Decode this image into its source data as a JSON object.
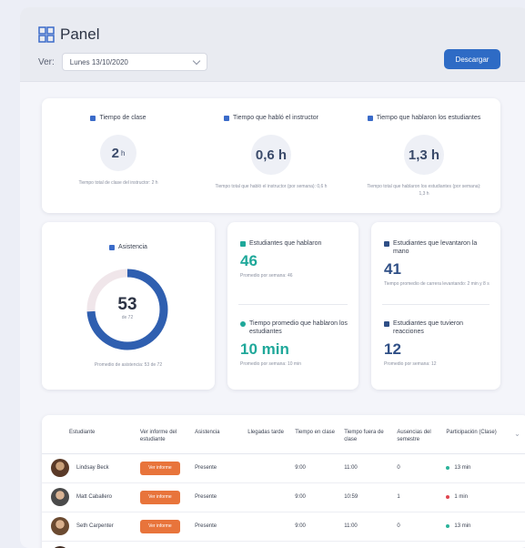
{
  "header": {
    "title": "Panel",
    "view_label": "Ver:",
    "date_value": "Lunes 13/10/2020",
    "download_label": "Descargar"
  },
  "stats": [
    {
      "label": "Tiempo de clase",
      "value": "2",
      "unit": "h",
      "note": "Tiempo total de clase del instructor: 2 h"
    },
    {
      "label": "Tiempo que habló el instructor",
      "value": "0,6 h",
      "unit": "",
      "note": "Tiempo total que habló el instructor (por semana): 0,6 h"
    },
    {
      "label": "Tiempo que hablaron los estudiantes",
      "value": "1,3 h",
      "unit": "",
      "note": "Tiempo total que hablaron los estudiantes (por semana): 1,3 h"
    }
  ],
  "attendance": {
    "label": "Asistencia",
    "value": "53",
    "sub": "de 72",
    "note": "Promedio de asistencia: 53 de 72",
    "fraction": 0.74
  },
  "metrics": {
    "students_talked": {
      "label": "Estudiantes que hablaron",
      "value": "46",
      "note": "Promedio por semana: 46"
    },
    "avg_talk_time": {
      "label": "Tiempo promedio que hablaron los estudiantes",
      "value": "10 min",
      "note": "Promedio por semana: 10 min"
    },
    "raised_hand": {
      "label": "Estudiantes que levantaron la mano",
      "value": "41",
      "note": "Tiempo promedio de carrera levantando: 2 min y 8 s"
    },
    "reactions": {
      "label": "Estudiantes que tuvieron reacciones",
      "value": "12",
      "note": "Promedio por semana: 12"
    }
  },
  "table": {
    "columns": [
      "Estudiante",
      "Ver informe del estudiante",
      "Asistencia",
      "Llegadas tarde",
      "Tiempo en clase",
      "Tiempo fuera de clase",
      "Ausencias del semestre",
      "Participación (Clase)"
    ],
    "rows": [
      {
        "name": "Lindsay Beck",
        "report": "Ver informe",
        "attendance": "Presente",
        "late": "",
        "in_class": "9:00",
        "out_class": "11:00",
        "absences": "0",
        "participation": "13 min",
        "part_color": "#2bb39a"
      },
      {
        "name": "Matt Caballero",
        "report": "Ver informe",
        "attendance": "Presente",
        "late": "",
        "in_class": "9:00",
        "out_class": "10:59",
        "absences": "1",
        "participation": "1 min",
        "part_color": "#e0454f"
      },
      {
        "name": "Seth Carpenter",
        "report": "Ver informe",
        "attendance": "Presente",
        "late": "",
        "in_class": "9:00",
        "out_class": "11:00",
        "absences": "0",
        "participation": "13 min",
        "part_color": "#2bb39a"
      }
    ]
  },
  "colors": {
    "accent": "#2e6bc5",
    "teal": "#1fa89a",
    "navy": "#2f4f86",
    "orange": "#e8743b"
  }
}
